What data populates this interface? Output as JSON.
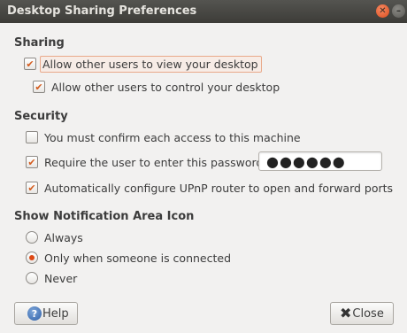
{
  "window": {
    "title": "Desktop Sharing Preferences",
    "close_glyph": "✕",
    "minimize_glyph": "–"
  },
  "sharing": {
    "heading": "Sharing",
    "allow_view": {
      "label": "Allow other users to view your desktop",
      "checked": true,
      "check_glyph": "✔"
    },
    "allow_control": {
      "label": "Allow other users to control your desktop",
      "checked": true,
      "check_glyph": "✔"
    }
  },
  "security": {
    "heading": "Security",
    "confirm_access": {
      "label": "You must confirm each access to this machine",
      "checked": false,
      "check_glyph": ""
    },
    "require_password": {
      "label": "Require the user to enter this password:",
      "checked": true,
      "check_glyph": "✔"
    },
    "password_value": "●●●●●●",
    "upnp": {
      "label": "Automatically configure UPnP router to open and forward ports",
      "checked": true,
      "check_glyph": "✔"
    }
  },
  "notification": {
    "heading": "Show Notification Area Icon",
    "options": [
      {
        "label": "Always",
        "selected": false
      },
      {
        "label": "Only when someone is connected",
        "selected": true
      },
      {
        "label": "Never",
        "selected": false
      }
    ]
  },
  "buttons": {
    "help_label": "Help",
    "help_icon_glyph": "?",
    "close_label": "Close",
    "close_icon_glyph": "✖"
  },
  "colors": {
    "accent": "#dd4814",
    "titlebar": "#3d3c38",
    "background": "#f2f1f0"
  }
}
